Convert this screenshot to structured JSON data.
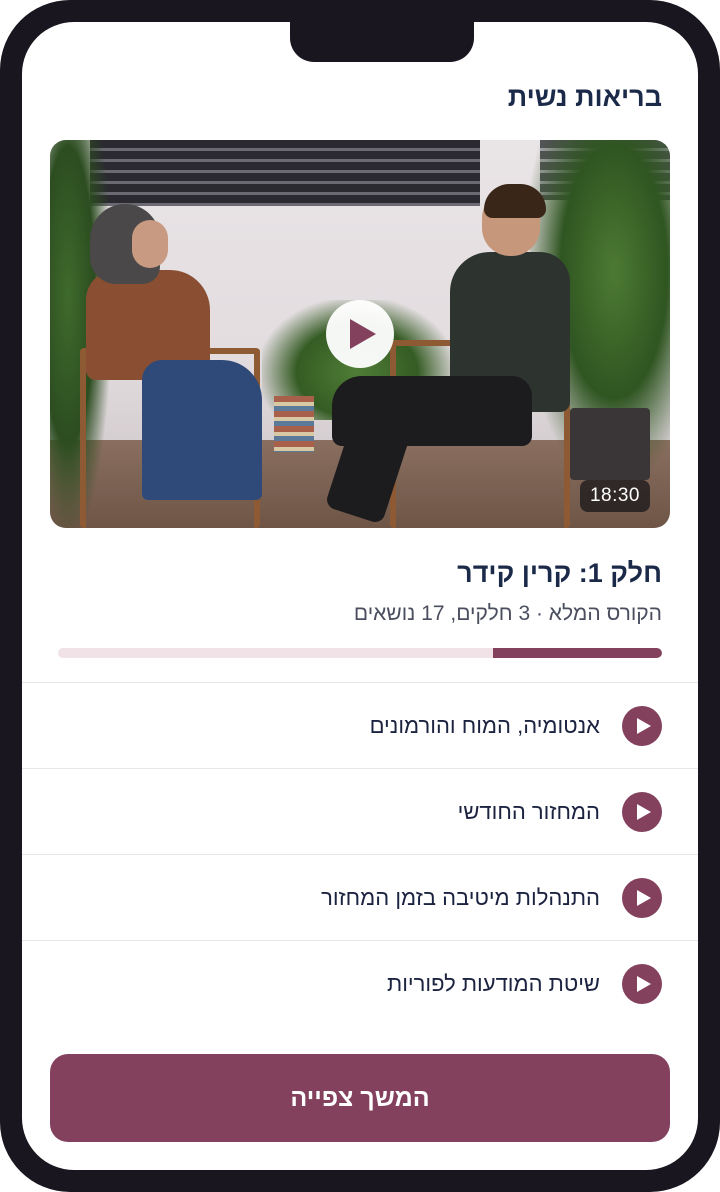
{
  "header": {
    "title": "בריאות נשית"
  },
  "video": {
    "duration": "18:30",
    "play_icon": "play-icon"
  },
  "episode": {
    "title": "חלק 1: קרין קידר",
    "meta": "הקורס המלא · 3 חלקים, 17 נושאים",
    "progress_percent": 28
  },
  "topics": [
    {
      "label": "אנטומיה, המוח והורמונים",
      "icon": "play-icon"
    },
    {
      "label": "המחזור החודשי",
      "icon": "play-icon"
    },
    {
      "label": "התנהלות מיטיבה בזמן המחזור",
      "icon": "play-icon"
    },
    {
      "label": "שיטת המודעות לפוריות",
      "icon": "play-icon"
    }
  ],
  "cta": {
    "label": "המשך צפייה"
  },
  "colors": {
    "accent": "#84415e",
    "progress_track": "#f0e2e7",
    "title_text": "#1c2a4a"
  }
}
